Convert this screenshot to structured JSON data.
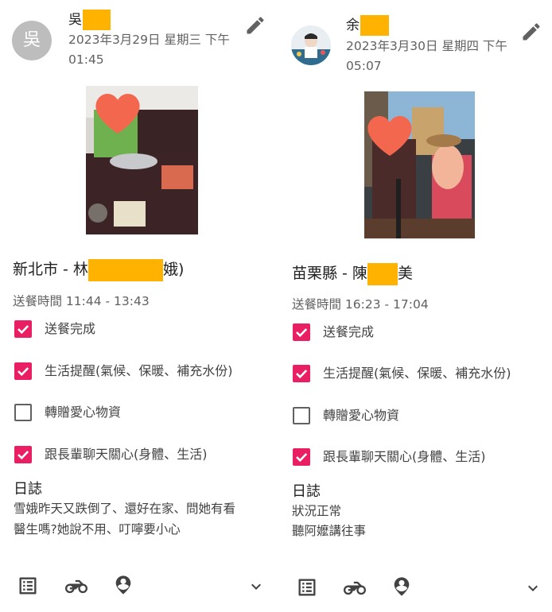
{
  "cards": [
    {
      "avatar_letter": "吳",
      "name": "吳",
      "date": "2023年3月29日 星期三 下午01:45",
      "title_prefix": "新北市 - 林",
      "title_suffix": "娥)",
      "delivery_time": "送餐時間 11:44 - 13:43",
      "checklist": [
        {
          "label": "送餐完成",
          "checked": true
        },
        {
          "label": "生活提醒(氣候、保暖、補充水份)",
          "checked": true
        },
        {
          "label": "轉贈愛心物資",
          "checked": false
        },
        {
          "label": "跟長輩聊天關心(身體、生活)",
          "checked": true
        }
      ],
      "log_heading": "日誌",
      "log_lines": [
        "雪娥昨天又跌倒了、還好在家、問她有看",
        "醫生嗎?她說不用、叮嚀要小心"
      ]
    },
    {
      "name": "余",
      "date": "2023年3月30日 星期四 下午05:07",
      "title_prefix": "苗栗縣 - 陳",
      "title_suffix": "美",
      "delivery_time": "送餐時間 16:23 - 17:04",
      "checklist": [
        {
          "label": "送餐完成",
          "checked": true
        },
        {
          "label": "生活提醒(氣候、保暖、補充水份)",
          "checked": true
        },
        {
          "label": "轉贈愛心物資",
          "checked": false
        },
        {
          "label": "跟長輩聊天關心(身體、生活)",
          "checked": true
        }
      ],
      "log_heading": "日誌",
      "log_lines": [
        "狀況正常",
        "聽阿嬤講往事"
      ]
    }
  ],
  "colors": {
    "accent": "#e91e63",
    "redaction": "#ffb300",
    "heart": "#f4674f",
    "icon": "#424242"
  },
  "icons": [
    "edit-icon",
    "list-icon",
    "motorcycle-icon",
    "location-pin-icon",
    "chevron-down-icon"
  ]
}
